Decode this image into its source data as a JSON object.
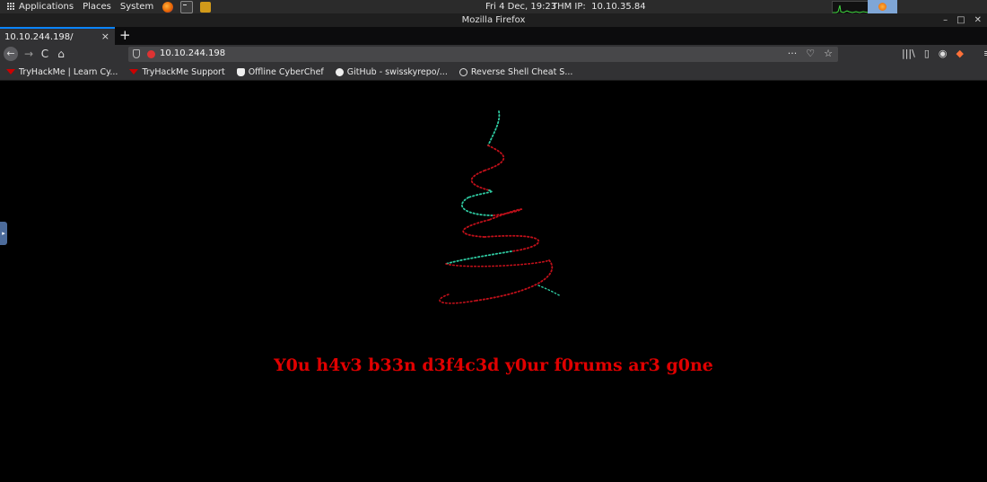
{
  "panel": {
    "menus": [
      "Applications",
      "Places",
      "System"
    ],
    "clock": "Fri  4 Dec, 19:23",
    "thm_ip_label": "THM IP:",
    "thm_ip_value": "10.10.35.84"
  },
  "window": {
    "title": "Mozilla Firefox",
    "minimize": "–",
    "maximize": "□",
    "close": "✕"
  },
  "tab": {
    "label": "10.10.244.198/",
    "close": "×",
    "new_tab": "+"
  },
  "nav": {
    "back": "←",
    "forward": "→",
    "reload": "C",
    "home": "⌂",
    "url": "10.10.244.198",
    "more": "···",
    "pocket": "♡",
    "star": "☆",
    "library": "|||\\",
    "sidebar": "▯",
    "account": "◉",
    "extension": "◆",
    "menu": "≡"
  },
  "bookmarks": [
    {
      "label": "TryHackMe | Learn Cy...",
      "icon": "tryhackme-icon"
    },
    {
      "label": "TryHackMe Support",
      "icon": "tryhackme-icon"
    },
    {
      "label": "Offline CyberChef",
      "icon": "chef-icon"
    },
    {
      "label": "GitHub - swisskyrepo/...",
      "icon": "github-icon"
    },
    {
      "label": "Reverse Shell Cheat S...",
      "icon": "globe-icon"
    }
  ],
  "page": {
    "message": "Y0u h4v3 b33n d3f4c3d y0ur f0rums ar3 g0ne",
    "message_color": "#e00000"
  },
  "colors": {
    "tree_red": "#c0101a",
    "tree_green": "#2ec9a0",
    "accent_blue": "#0a84ff"
  }
}
